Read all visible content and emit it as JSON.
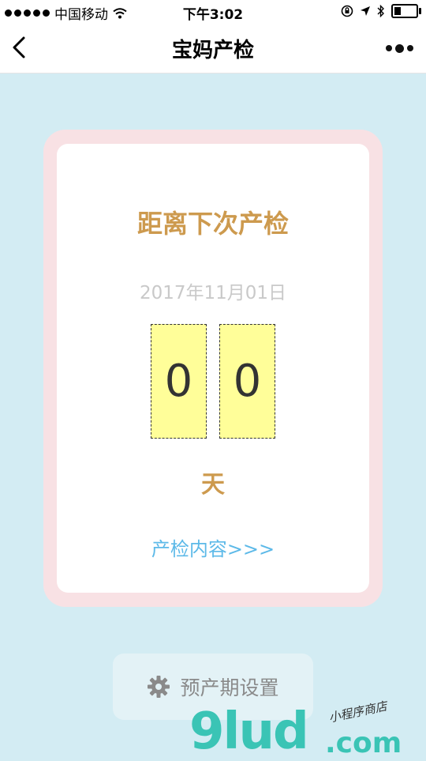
{
  "status_bar": {
    "carrier": "中国移动",
    "time": "下午3:02",
    "battery_level": 0.3
  },
  "nav": {
    "title": "宝妈产检",
    "back_icon": "chevron-left-icon",
    "more_icon": "more-dots-icon"
  },
  "card": {
    "title": "距离下次产检",
    "date": "2017年11月01日",
    "digits": [
      "0",
      "0"
    ],
    "unit": "天",
    "link": "产检内容>>>"
  },
  "settings": {
    "label": "预产期设置",
    "icon": "gear-icon"
  },
  "watermark": {
    "brand": "9lud",
    "domain": ".com",
    "slogan": "小程序商店"
  },
  "colors": {
    "background": "#d3ecf3",
    "card_border": "#f8e1e4",
    "accent_gold": "#cd9a4e",
    "digit_bg": "#fffe99",
    "link_blue": "#5cb9e8"
  }
}
